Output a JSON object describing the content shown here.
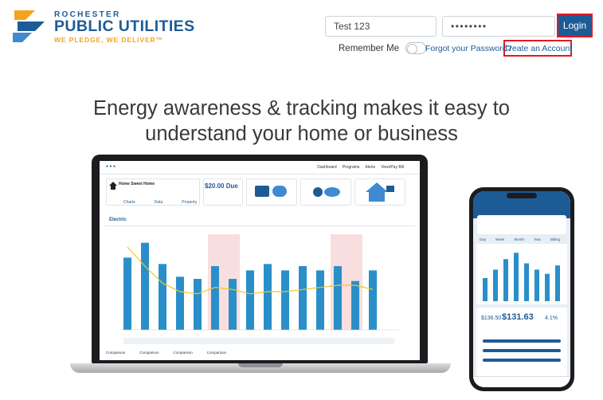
{
  "brand": {
    "top_text": "ROCHESTER",
    "name": "PUBLIC UTILITIES",
    "tagline": "WE PLEDGE, WE DELIVER™",
    "primary_color": "#1d5b96",
    "accent_color": "#f5a31b",
    "highlight_color": "#e11a22"
  },
  "login": {
    "username_value": "Test 123",
    "password_value": "••••••••",
    "login_label": "Login",
    "remember_label": "Remember Me",
    "remember_on": false,
    "forgot_label": "Forgot your Password?",
    "create_label": "Create an Account"
  },
  "hero": {
    "line1": "Energy awareness & tracking makes it easy to",
    "line2": "understand your home or business"
  },
  "laptop_screen": {
    "nav": [
      "Dashboard",
      "Programs",
      "Alerts",
      "View/Pay Bill"
    ],
    "home_name": "Home Sweet Home",
    "due": "$20.00 Due",
    "tabs": [
      "Charts",
      "Data",
      "Property"
    ],
    "fuel": "Electric",
    "footer": [
      "Comparison",
      "Comparison",
      "Comparison",
      "Comparison"
    ],
    "bars": [
      34,
      41,
      31,
      25,
      24,
      30,
      24,
      28,
      31,
      28,
      30,
      28,
      30,
      23,
      28
    ],
    "temp_line": [
      39,
      30,
      22,
      18,
      17,
      20,
      19,
      17,
      18,
      18,
      19,
      20,
      21,
      21,
      19
    ]
  },
  "phone_screen": {
    "tabs": [
      "Day",
      "Week",
      "Month",
      "Year",
      "Billing"
    ],
    "amount": "$131.63",
    "left_value": "$136.50",
    "right_value": "4.1%",
    "bars": [
      22,
      30,
      40,
      46,
      36,
      30,
      26,
      34
    ]
  }
}
